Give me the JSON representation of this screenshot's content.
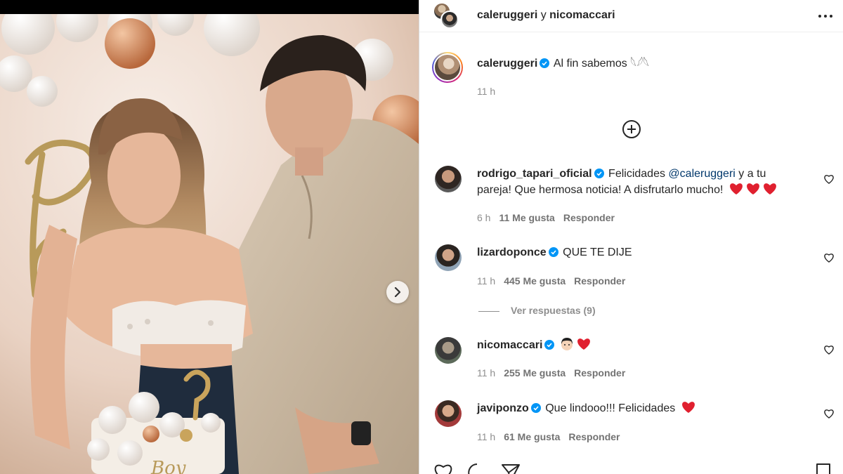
{
  "post": {
    "collaborators_title": {
      "user1": "caleruggeri",
      "joiner": " y ",
      "user2": "nicomaccari"
    },
    "caption": {
      "user": "caleruggeri",
      "text": "Al fin sabemos 𓆩𓆪𓆩",
      "time": "11 h"
    }
  },
  "comments": [
    {
      "user": "rodrigo_tapari_oficial",
      "text_before": "Felicidades ",
      "mention": "@caleruggeri",
      "text_after": " y a tu",
      "text_line2": "pareja! Que hermosa noticia! A disfrutarlo mucho! ",
      "time": "6 h",
      "likes": "11 Me gusta",
      "reply": "Responder"
    },
    {
      "user": "lizardoponce",
      "text": "QUE TE DIJE",
      "time": "11 h",
      "likes": "445 Me gusta",
      "reply": "Responder",
      "view_replies": "Ver respuestas (9)"
    },
    {
      "user": "nicomaccari",
      "text": "",
      "time": "11 h",
      "likes": "255 Me gusta",
      "reply": "Responder"
    },
    {
      "user": "javiponzo",
      "text": "Que lindooo!!! Felicidades ",
      "time": "11 h",
      "likes": "61 Me gusta",
      "reply": "Responder"
    }
  ],
  "colors": {
    "verified": "#0095f6",
    "heart": "#ed4956",
    "link": "#00376b",
    "muted": "#8e8e8e"
  },
  "icons": [
    "more-icon",
    "add-comment-icon",
    "heart-outline-icon",
    "verified-icon",
    "next-arrow-icon",
    "like-icon",
    "comment-icon",
    "share-icon",
    "save-icon"
  ]
}
